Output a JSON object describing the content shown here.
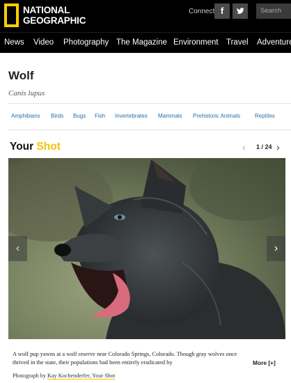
{
  "header": {
    "logo_line1": "NATIONAL",
    "logo_line2": "GEOGRAPHIC",
    "connect_label": "Connect:",
    "social": [
      {
        "label": "f",
        "icon": "facebook-icon"
      },
      {
        "label": "t",
        "icon": "twitter-icon"
      }
    ],
    "search_placeholder": "Search"
  },
  "nav": {
    "items": [
      "News",
      "Video",
      "Photography",
      "The Magazine",
      "Environment",
      "Travel",
      "Adventure"
    ]
  },
  "page": {
    "title": "Wolf",
    "scientific_name": "Canis lupus"
  },
  "categories": [
    "Amphibians",
    "Birds",
    "Bugs",
    "Fish",
    "Invertebrates",
    "Mammals",
    "Prehistoric Animals",
    "Reptiles"
  ],
  "your_shot": {
    "title_part1": "Your",
    "title_part2": "Shot",
    "prev_icon": "‹",
    "counter": "1 / 24",
    "next_icon": "›",
    "photo_alt": "Wolf pup yawning",
    "caption": "A wolf pup yawns at a wolf reserve near Colorado Springs, Colorado. Though gray wolves once thrived in the state, their populations had been entirely eradicated by",
    "more_label": "More [+]",
    "credit_prefix": "Photograph by",
    "credit_link": "Kay Kochenderfer, Your Shot"
  },
  "colors": {
    "accent": "#ffce00",
    "link": "#2a6ea8",
    "header_bg": "#000000"
  }
}
